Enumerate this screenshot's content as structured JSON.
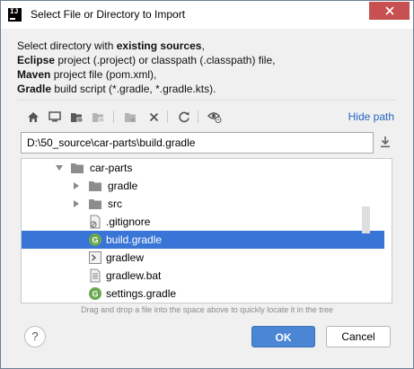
{
  "window": {
    "title": "Select File or Directory to Import",
    "app_icon_text": "IJ"
  },
  "description": {
    "line1_pre": "Select directory with ",
    "line1_bold": "existing sources",
    "line1_post": ",",
    "line2_bold": "Eclipse",
    "line2_post": " project (.project) or classpath (.classpath) file,",
    "line3_bold": "Maven",
    "line3_post": " project file (pom.xml),",
    "line4_bold": "Gradle",
    "line4_post": " build script (*.gradle, *.gradle.kts)."
  },
  "toolbar": {
    "icons": [
      "home-icon",
      "desktop-icon",
      "project-folder-icon",
      "module-folder-icon",
      "new-folder-icon",
      "delete-icon",
      "refresh-icon",
      "show-hidden-icon"
    ],
    "hide_path_label": "Hide path"
  },
  "path_input": {
    "value": "D:\\50_source\\car-parts\\build.gradle"
  },
  "tree": {
    "items": [
      {
        "label": "car-parts",
        "type": "folder",
        "expanded": true,
        "depth": 0
      },
      {
        "label": "gradle",
        "type": "folder",
        "expanded": false,
        "depth": 1
      },
      {
        "label": "src",
        "type": "folder",
        "expanded": false,
        "depth": 1
      },
      {
        "label": ".gitignore",
        "type": "file-ignore",
        "depth": 1
      },
      {
        "label": "build.gradle",
        "type": "gradle",
        "depth": 1,
        "selected": true
      },
      {
        "label": "gradlew",
        "type": "script",
        "depth": 1
      },
      {
        "label": "gradlew.bat",
        "type": "text",
        "depth": 1
      },
      {
        "label": "settings.gradle",
        "type": "gradle",
        "depth": 1
      }
    ]
  },
  "hint": "Drag and drop a file into the space above to quickly locate it in the tree",
  "buttons": {
    "help": "?",
    "ok": "OK",
    "cancel": "Cancel"
  },
  "colors": {
    "accent": "#3875d6",
    "link": "#2566c2",
    "close": "#c75050",
    "gradle_green": "#6aa84f"
  }
}
